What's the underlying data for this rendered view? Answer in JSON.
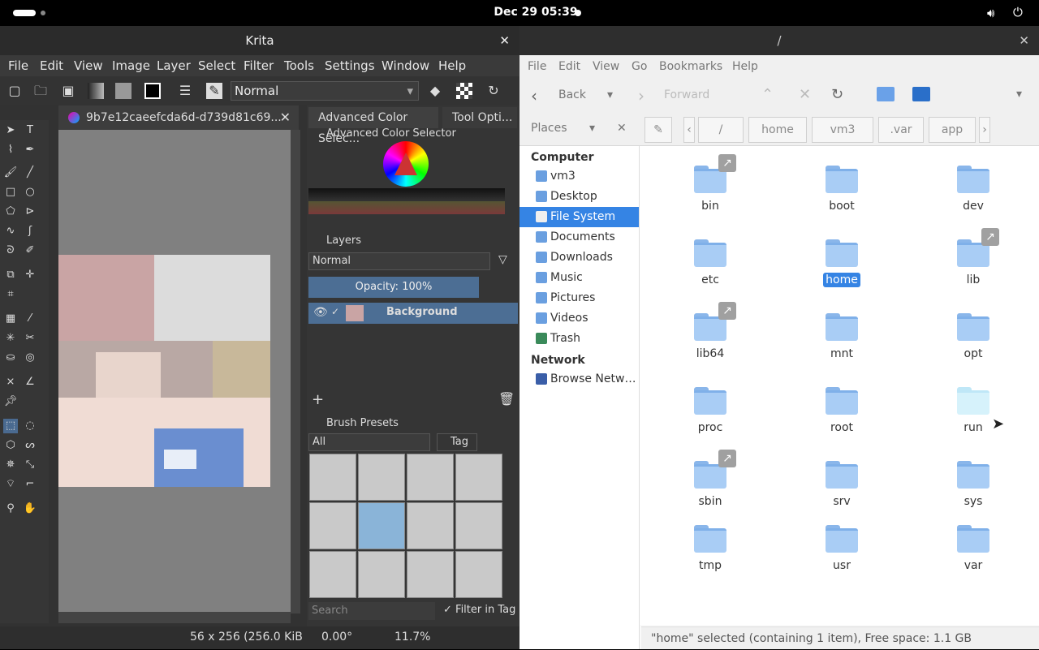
{
  "topbar": {
    "clock": "Dec 29  05:39"
  },
  "krita": {
    "title": "Krita",
    "menu": [
      "File",
      "Edit",
      "View",
      "Image",
      "Layer",
      "Select",
      "Filter",
      "Tools",
      "Settings",
      "Window",
      "Help"
    ],
    "blend_mode": "Normal",
    "doc_tab": "9b7e12caeefcda6d-d739d81c69...",
    "panels": {
      "color_tab": "Advanced Color Selec...",
      "tool_tab": "Tool Opti...",
      "color_title": "Advanced Color Selector",
      "layers_title": "Layers",
      "layers_blend": "Normal",
      "opacity": "Opacity:  100%",
      "layer_name": "Background",
      "brush_title": "Brush Presets",
      "brush_filter": "All",
      "tag": "Tag",
      "search_placeholder": "Search",
      "filter_in_tag": "Filter in Tag"
    },
    "status": {
      "size": "56 x 256 (256.0 KiB",
      "rotation": "0.00°",
      "zoom": "11.7%"
    }
  },
  "files": {
    "title": "/",
    "menu": [
      "File",
      "Edit",
      "View",
      "Go",
      "Bookmarks",
      "Help"
    ],
    "toolbar": {
      "back": "Back",
      "forward": "Forward"
    },
    "places_label": "Places",
    "crumbs": [
      "/",
      "home",
      "vm3",
      ".var",
      "app"
    ],
    "sidebar": {
      "computer_head": "Computer",
      "items": [
        "vm3",
        "Desktop",
        "File System",
        "Documents",
        "Downloads",
        "Music",
        "Pictures",
        "Videos",
        "Trash"
      ],
      "network_head": "Network",
      "network_items": [
        "Browse Netw…"
      ]
    },
    "folders": [
      "bin",
      "boot",
      "dev",
      "etc",
      "home",
      "lib",
      "lib64",
      "mnt",
      "opt",
      "proc",
      "root",
      "run",
      "sbin",
      "srv",
      "sys",
      "tmp",
      "usr",
      "var"
    ],
    "status": "\"home\" selected (containing 1 item), Free space: 1.1 GB"
  },
  "colors": {
    "accent": "#3584e4",
    "krita_bg": "#323232",
    "folder": "#a9cdf5"
  }
}
